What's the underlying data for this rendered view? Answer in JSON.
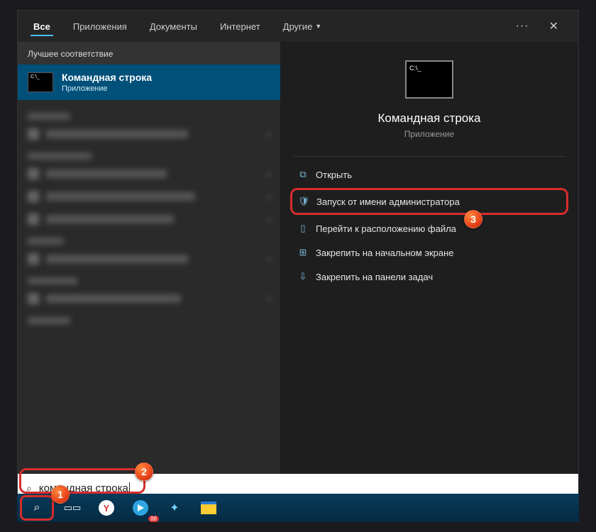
{
  "tabs": {
    "all": "Все",
    "apps": "Приложения",
    "docs": "Документы",
    "internet": "Интернет",
    "more": "Другие"
  },
  "left": {
    "best_match_label": "Лучшее соответствие",
    "result_title": "Командная строка",
    "result_subtitle": "Приложение"
  },
  "right": {
    "title": "Командная строка",
    "subtitle": "Приложение",
    "actions": {
      "open": "Открыть",
      "run_admin": "Запуск от имени администратора",
      "open_location": "Перейти к расположению файла",
      "pin_start": "Закрепить на начальном экране",
      "pin_taskbar": "Закрепить на панели задач"
    }
  },
  "search": {
    "query": "командная строка"
  },
  "callouts": {
    "one": "1",
    "two": "2",
    "three": "3"
  }
}
